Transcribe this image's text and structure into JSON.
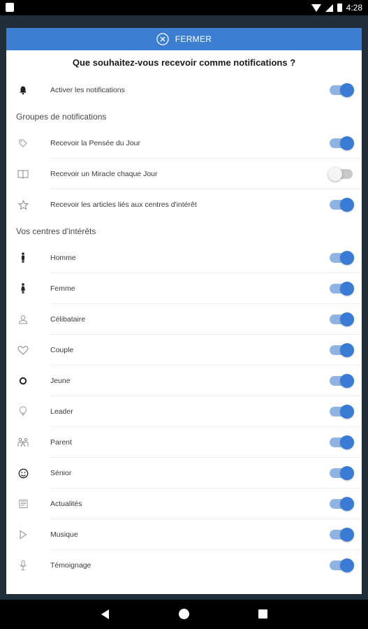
{
  "status_bar": {
    "time": "4:28"
  },
  "dialog": {
    "close_label": "FERMER",
    "title": "Que souhaitez-vous recevoir comme notifications ?"
  },
  "main_toggle": {
    "label": "Activer les notifications",
    "on": true,
    "icon": "bell-icon"
  },
  "groups": {
    "header": "Groupes de notifications",
    "items": [
      {
        "label": "Recevoir la Pensée du Jour",
        "on": true,
        "icon": "tag-icon"
      },
      {
        "label": "Recevoir un Miracle chaque Jour",
        "on": false,
        "icon": "book-icon"
      },
      {
        "label": "Recevoir les articles liés aux centres d'intérêt",
        "on": true,
        "icon": "star-icon"
      }
    ]
  },
  "interests": {
    "header": "Vos centres d'intérêts",
    "items": [
      {
        "label": "Homme",
        "on": true,
        "icon": "man-icon"
      },
      {
        "label": "Femme",
        "on": true,
        "icon": "woman-icon"
      },
      {
        "label": "Célibataire",
        "on": true,
        "icon": "person-icon"
      },
      {
        "label": "Couple",
        "on": true,
        "icon": "heart-icon"
      },
      {
        "label": "Jeune",
        "on": true,
        "icon": "circle-icon"
      },
      {
        "label": "Leader",
        "on": true,
        "icon": "lightbulb-icon"
      },
      {
        "label": "Parent",
        "on": true,
        "icon": "family-icon"
      },
      {
        "label": "Sénior",
        "on": true,
        "icon": "smiley-icon"
      },
      {
        "label": "Actualités",
        "on": true,
        "icon": "newspaper-icon"
      },
      {
        "label": "Musique",
        "on": true,
        "icon": "play-icon"
      },
      {
        "label": "Témoignage",
        "on": true,
        "icon": "microphone-icon"
      }
    ]
  }
}
